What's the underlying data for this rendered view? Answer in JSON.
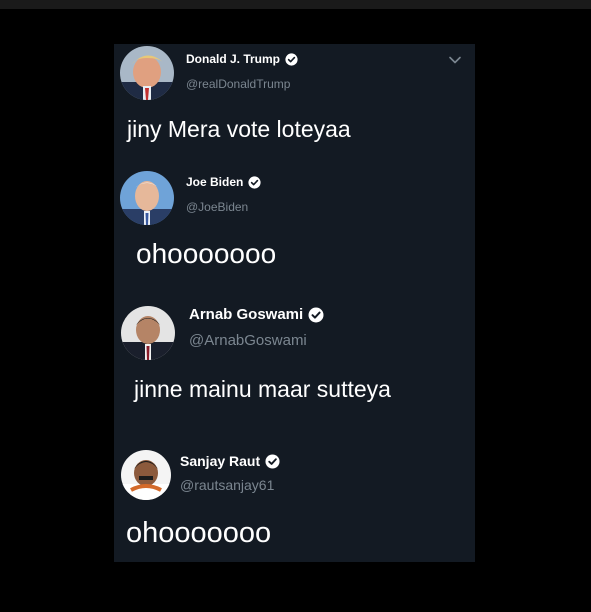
{
  "colors": {
    "background": "#000000",
    "card": "#131a23",
    "text": "#ffffff",
    "handle": "#7b8690",
    "verified_badge": "#ffffff"
  },
  "tweets": [
    {
      "display_name": "Donald J. Trump",
      "handle": "@realDonaldTrump",
      "text": "jiny Mera vote loteyaa",
      "verified_icon": "verified-badge-icon",
      "menu_icon": "chevron-down-icon"
    },
    {
      "display_name": "Joe Biden",
      "handle": "@JoeBiden",
      "text": "ohooooooo",
      "verified_icon": "verified-badge-icon"
    },
    {
      "display_name": "Arnab Goswami",
      "handle": "@ArnabGoswami",
      "text": "jinne mainu maar sutteya",
      "verified_icon": "verified-badge-icon"
    },
    {
      "display_name": "Sanjay Raut",
      "handle": "@rautsanjay61",
      "text": "ohooooooo",
      "verified_icon": "verified-badge-icon"
    }
  ]
}
